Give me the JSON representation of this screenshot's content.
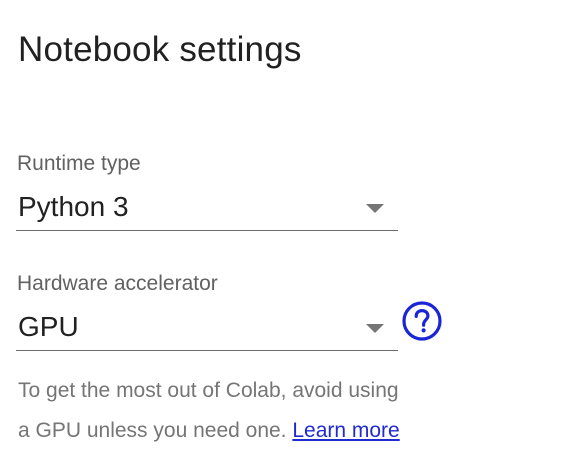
{
  "dialog": {
    "title": "Notebook settings"
  },
  "runtime_type": {
    "label": "Runtime type",
    "value": "Python 3"
  },
  "hardware_accelerator": {
    "label": "Hardware accelerator",
    "value": "GPU",
    "help_icon": "help-circle-icon"
  },
  "hint": {
    "line1": "To get the most out of Colab, avoid using",
    "line2_prefix": "a GPU unless you need one. ",
    "link": "Learn more"
  },
  "colors": {
    "link": "#1f2bd1",
    "help_icon": "#1a26d6",
    "text": "#212121",
    "secondary_text": "#616161",
    "underline": "#6b6b6b"
  }
}
